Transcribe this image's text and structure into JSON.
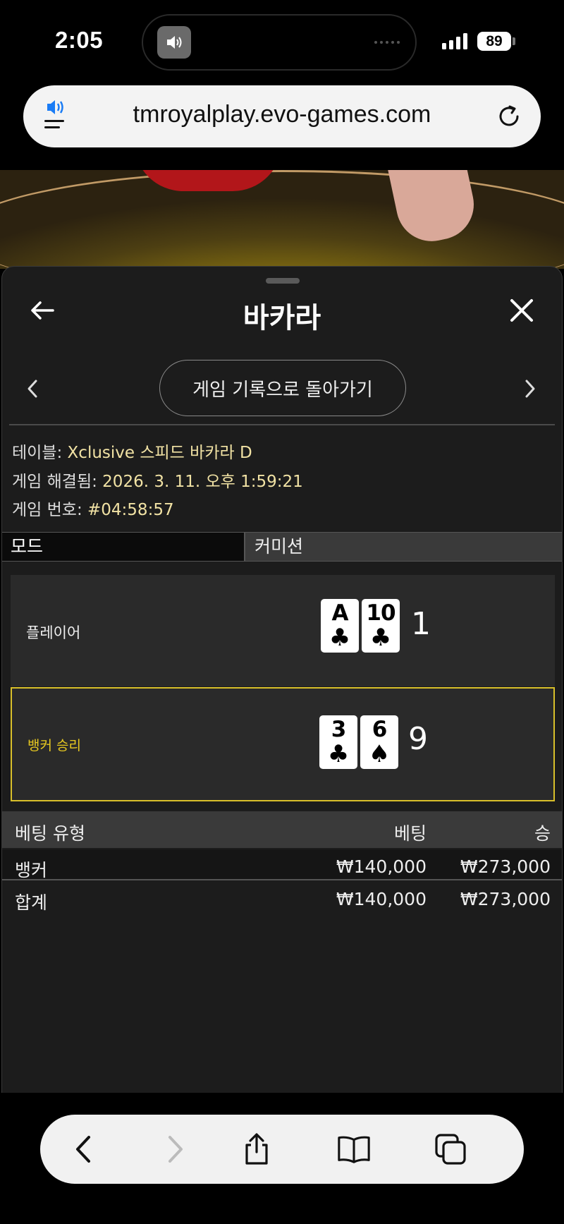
{
  "status": {
    "time": "2:05",
    "battery": "89"
  },
  "browser": {
    "url": "tmroyalplay.evo-games.com"
  },
  "panel": {
    "title": "바카라",
    "history_button": "게임 기록으로 돌아가기",
    "info": {
      "table_label": "테이블: ",
      "table_value": "Xclusive 스피드 바카라 D",
      "resolved_label": "게임 해결됨: ",
      "resolved_value": "2026. 3. 11. 오후 1:59:21",
      "number_label": "게임 번호: ",
      "number_value": "#04:58:57"
    },
    "mode": {
      "left": "모드",
      "right": "커미션"
    },
    "hands": {
      "player": {
        "label": "플레이어",
        "cards": [
          {
            "rank": "A",
            "suit": "♣"
          },
          {
            "rank": "10",
            "suit": "♣"
          }
        ],
        "score": "1"
      },
      "banker": {
        "label": "뱅커 승리",
        "cards": [
          {
            "rank": "3",
            "suit": "♣"
          },
          {
            "rank": "6",
            "suit": "♠"
          }
        ],
        "score": "9"
      }
    },
    "bets": {
      "headers": {
        "type": "베팅 유형",
        "bet": "베팅",
        "win": "승"
      },
      "rows": [
        {
          "type": "뱅커",
          "bet": "₩140,000",
          "win": "₩273,000"
        },
        {
          "type": "합계",
          "bet": "₩140,000",
          "win": "₩273,000"
        }
      ]
    }
  },
  "colors": {
    "accent_gold": "#d8bf2a",
    "info_value": "#f1e2a4",
    "panel_bg": "#1c1c1c"
  },
  "icons": {
    "status": [
      "speaker-icon",
      "signal-icon",
      "battery-icon"
    ],
    "url_bar": [
      "audio-menu-icon",
      "reload-icon"
    ],
    "panel": [
      "back-arrow-icon",
      "close-icon",
      "chevron-left-icon",
      "chevron-right-icon"
    ],
    "toolbar": [
      "back-icon",
      "forward-icon",
      "share-icon",
      "bookmarks-icon",
      "tabs-icon"
    ]
  }
}
